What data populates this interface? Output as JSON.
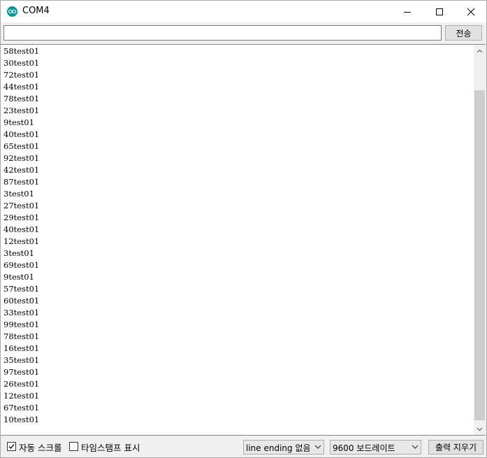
{
  "window": {
    "title": "COM4",
    "accent_color": "#00979c",
    "controls": [
      "minimize-icon",
      "maximize-icon",
      "close-icon"
    ]
  },
  "send": {
    "input_value": "",
    "input_placeholder": "",
    "button_label": "전송"
  },
  "output": {
    "lines": [
      "58test01",
      "30test01",
      "72test01",
      "44test01",
      "78test01",
      "23test01",
      "9test01",
      "40test01",
      "65test01",
      "92test01",
      "42test01",
      "87test01",
      "3test01",
      "27test01",
      "29test01",
      "40test01",
      "12test01",
      "3test01",
      "69test01",
      "9test01",
      "57test01",
      "60test01",
      "33test01",
      "99test01",
      "78test01",
      "16test01",
      "35test01",
      "97test01",
      "26test01",
      "12test01",
      "67test01",
      "10test01"
    ]
  },
  "footer": {
    "autoscroll": {
      "label": "자동 스크롤",
      "checked": true
    },
    "timestamp": {
      "label": "타임스탬프 표시",
      "checked": false
    },
    "line_ending": {
      "selected": "line ending 없음"
    },
    "baud_rate": {
      "selected": "9600 보드레이트"
    },
    "clear_button_label": "출력 지우기"
  }
}
